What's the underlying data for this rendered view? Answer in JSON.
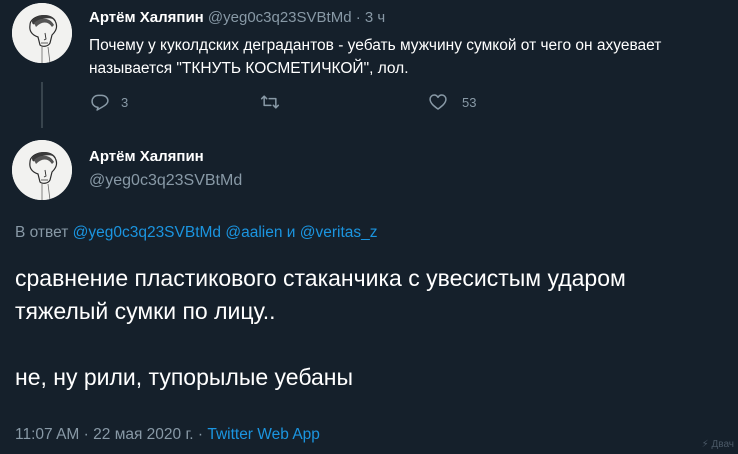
{
  "colors": {
    "background": "#15202b",
    "text": "#ffffff",
    "muted": "#8899a6",
    "link": "#1b95e0",
    "thread_line": "#38444d"
  },
  "parent_tweet": {
    "avatar_icon": "sketch-portrait-avatar",
    "display_name": "Артём Халяпин",
    "handle": "@yeg0c3q23SVBtMd",
    "separator": "·",
    "time": "3 ч",
    "text": "Почему у куколдских деградантов - уебать мужчину сумкой от чего он ахуевает называется \"ТКНУТЬ КОСМЕТИЧКОЙ\", лол.",
    "reply_count": "3",
    "like_count": "53",
    "icons": [
      "reply-icon",
      "retweet-icon",
      "like-icon"
    ]
  },
  "main_tweet": {
    "avatar_icon": "sketch-portrait-avatar",
    "display_name": "Артём Халяпин",
    "handle": "@yeg0c3q23SVBtMd",
    "reply_prefix": "В ответ",
    "reply_mention_1": "@yeg0c3q23SVBtMd",
    "reply_mention_2": "@aalien",
    "reply_conjunction": "и",
    "reply_mention_3": "@veritas_z",
    "paragraph_1": "сравнение пластикового стаканчика с увесистым ударом тяжелый сумки по лицу..",
    "paragraph_2": "не, ну рили, тупорылые уебаны",
    "time": "11:07 AM",
    "dot": "·",
    "date": "22 мая 2020 г.",
    "dot2": "·",
    "source": "Twitter Web App"
  },
  "watermark": "Двач"
}
